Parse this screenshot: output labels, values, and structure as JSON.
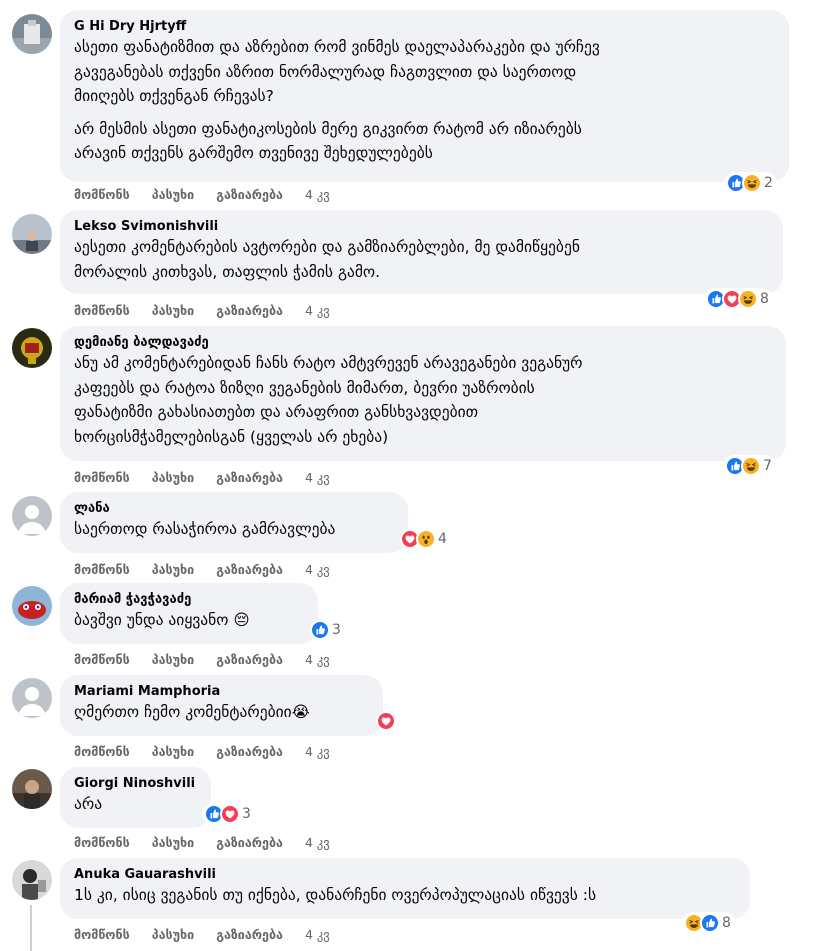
{
  "comments": [
    {
      "author": "G Hi Dry Hjrtyff",
      "paragraphs": [
        [
          "ასეთი ფანატიზმით და აზრებით რომ ვინმეს დაელაპარაკები და ურჩევ",
          "გავეგანებას თქვენი აზრით ნორმალურად ჩაგთვლით და საერთოდ",
          "მიიღებს თქვენგან რჩევას?"
        ],
        [
          "არ მესმის ასეთი ფანატიკოსების მერე გიკვირთ რატომ არ იზიარებს",
          "არავინ თქვენს გარშემო თვენივე შეხედულებებს"
        ]
      ],
      "reactions": [
        "like",
        "haha"
      ],
      "reaction_count": "2",
      "actions": {
        "like": "მომწონს",
        "reply": "პასუხი",
        "share": "გაზიარება",
        "time": "4 კვ"
      }
    },
    {
      "author": "Lekso Svimonishvili",
      "paragraphs": [
        [
          "აესეთი კომენტარების ავტორები და გამზიარებლები, მე დამიწყებენ",
          "მორალის კითხვას, თაფლის ჭამის გამო."
        ]
      ],
      "reactions": [
        "like",
        "love",
        "haha"
      ],
      "reaction_count": "8",
      "actions": {
        "like": "მომწონს",
        "reply": "პასუხი",
        "share": "გაზიარება",
        "time": "4 კვ"
      }
    },
    {
      "author": "დემიანე ბალდავაძე",
      "paragraphs": [
        [
          "ანუ ამ კომენტარებიდან ჩანს რატო ამტვრევენ არავეგანები ვეგანურ",
          "კაფეებს და რატოა ზიზღი ვეგანების მიმართ, ბევრი უაზრობის",
          "ფანატიზმი გახასიათებთ და არაფრით განსხვავდებით",
          "ხორცისმჭამელებისგან (ყველას არ ეხება)"
        ]
      ],
      "reactions": [
        "like",
        "haha"
      ],
      "reaction_count": "7",
      "actions": {
        "like": "მომწონს",
        "reply": "პასუხი",
        "share": "გაზიარება",
        "time": "4 კვ"
      }
    },
    {
      "author": "ლანა",
      "paragraphs": [
        [
          "საერთოდ რასაჭიროა გამრავლება"
        ]
      ],
      "reactions": [
        "love",
        "wow"
      ],
      "reaction_count": "4",
      "actions": {
        "like": "მომწონს",
        "reply": "პასუხი",
        "share": "გაზიარება",
        "time": "4 კვ"
      }
    },
    {
      "author": "მარიამ ჭავჭავაძე",
      "paragraphs": [
        [
          "ბავშვი უნდა აიყვანო 😔"
        ]
      ],
      "reactions": [
        "like"
      ],
      "reaction_count": "3",
      "actions": {
        "like": "მომწონს",
        "reply": "პასუხი",
        "share": "გაზიარება",
        "time": "4 კვ"
      }
    },
    {
      "author": "Mariami Mamphoria",
      "paragraphs": [
        [
          "ღმერთო ჩემო კომენტარებიი😭"
        ]
      ],
      "reactions": [
        "love"
      ],
      "reaction_count": "",
      "actions": {
        "like": "მომწონს",
        "reply": "პასუხი",
        "share": "გაზიარება",
        "time": "4 კვ"
      }
    },
    {
      "author": "Giorgi Ninoshvili",
      "paragraphs": [
        [
          "არა"
        ]
      ],
      "reactions": [
        "like",
        "love"
      ],
      "reaction_count": "3",
      "actions": {
        "like": "მომწონს",
        "reply": "პასუხი",
        "share": "გაზიარება",
        "time": "4 კვ"
      }
    },
    {
      "author": "Anuka Gauarashvili",
      "paragraphs": [
        [
          "1ს კი, ისიც ვეგანის თუ იქნება, დანარჩენი ოვერპოპულაციას იწვევს :ს"
        ]
      ],
      "reactions": [
        "haha",
        "like"
      ],
      "reaction_count": "8",
      "actions": {
        "like": "მომწონს",
        "reply": "პასუხი",
        "share": "გაზიარება",
        "time": "4 კვ"
      }
    }
  ],
  "colors": {
    "bubble": "#f0f2f5",
    "secondary_text": "#65676b",
    "like": "#1877f2",
    "love": "#f33e58",
    "haha": "#f7b125"
  }
}
